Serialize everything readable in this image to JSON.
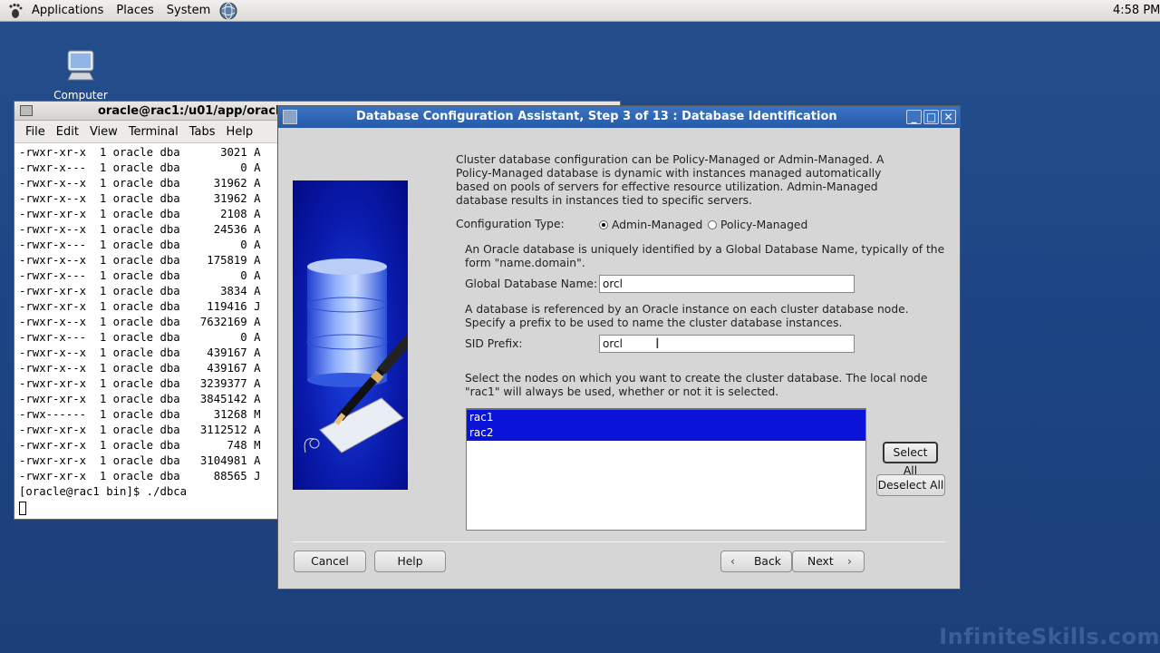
{
  "top_panel": {
    "menus": [
      "Applications",
      "Places",
      "System"
    ],
    "clock": "4:58 PM"
  },
  "desktop": {
    "icons": [
      {
        "label": "Computer"
      }
    ]
  },
  "terminal": {
    "title": "oracle@rac1:/u01/app/oracle",
    "menus": [
      "File",
      "Edit",
      "View",
      "Terminal",
      "Tabs",
      "Help"
    ],
    "lines": [
      "-rwxr-xr-x  1 oracle dba      3021 A",
      "-rwxr-x---  1 oracle dba         0 A",
      "-rwxr-x--x  1 oracle dba     31962 A",
      "-rwxr-x--x  1 oracle dba     31962 A",
      "-rwxr-xr-x  1 oracle dba      2108 A",
      "-rwxr-x--x  1 oracle dba     24536 A",
      "-rwxr-x---  1 oracle dba         0 A",
      "-rwxr-x--x  1 oracle dba    175819 A",
      "-rwxr-x---  1 oracle dba         0 A",
      "-rwxr-xr-x  1 oracle dba      3834 A",
      "-rwxr-xr-x  1 oracle dba    119416 J",
      "-rwxr-x--x  1 oracle dba   7632169 A",
      "-rwxr-x---  1 oracle dba         0 A",
      "-rwxr-x--x  1 oracle dba    439167 A",
      "-rwxr-x--x  1 oracle dba    439167 A",
      "-rwxr-xr-x  1 oracle dba   3239377 A",
      "-rwxr-xr-x  1 oracle dba   3845142 A",
      "-rwx------  1 oracle dba     31268 M",
      "-rwxr-xr-x  1 oracle dba   3112512 A",
      "-rwxr-xr-x  1 oracle dba       748 M",
      "-rwxr-xr-x  1 oracle dba   3104981 A",
      "-rwxr-xr-x  1 oracle dba     88565 J",
      "[oracle@rac1 bin]$ ./dbca"
    ]
  },
  "dialog": {
    "title": "Database Configuration Assistant, Step 3 of 13 : Database Identification",
    "intro": "Cluster database configuration can be Policy-Managed or Admin-Managed. A Policy-Managed database is dynamic with instances managed automatically based on pools of servers for effective resource utilization. Admin-Managed database results in instances tied to specific servers.",
    "config_type_label": "Configuration Type:",
    "config_options": [
      {
        "label": "Admin-Managed",
        "selected": true
      },
      {
        "label": "Policy-Managed",
        "selected": false
      }
    ],
    "gdn_desc": "An Oracle database is uniquely identified by a Global Database Name, typically of the form \"name.domain\".",
    "gdn_label": "Global Database Name:",
    "gdn_value": "orcl",
    "sid_desc": "A database is referenced by an Oracle instance on each cluster database node. Specify a prefix to be used to name the cluster database instances.",
    "sid_label": "SID Prefix:",
    "sid_value": "orcl",
    "nodes_desc": "Select the nodes on which you want to create the cluster database. The local node \"rac1\" will always be used, whether or not it is selected.",
    "nodes": [
      {
        "name": "rac1",
        "selected": true
      },
      {
        "name": "rac2",
        "selected": true
      }
    ],
    "buttons": {
      "select_all": "Select All",
      "deselect_all": "Deselect All",
      "cancel": "Cancel",
      "help": "Help",
      "back": "Back",
      "next": "Next"
    }
  },
  "watermark": "InfiniteSkills.com",
  "colors": {
    "desktop": "#1f4b8e",
    "titlebar": "#2f66b6",
    "selection": "#0a14d8"
  }
}
